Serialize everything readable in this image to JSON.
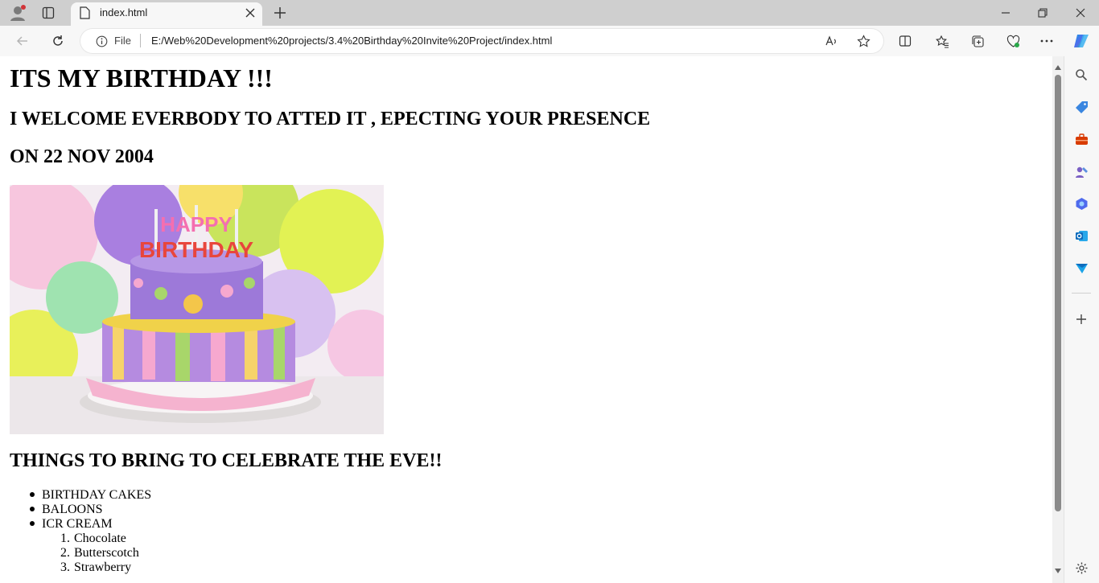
{
  "browser": {
    "tab_title": "index.html",
    "address_prefix": "File",
    "url": "E:/Web%20Development%20projects/3.4%20Birthday%20Invite%20Project/index.html"
  },
  "page": {
    "heading": "ITS MY BIRTHDAY !!!",
    "welcome": "I WELCOME EVERBODY TO ATTED IT , EPECTING YOUR PRESENCE",
    "date_line": "ON 22 NOV 2004",
    "image_text": "HAPPY BIRTHDAY",
    "things_heading": "THINGS TO BRING TO CELEBRATE THE EVE!!",
    "items": [
      "BIRTHDAY CAKES",
      "BALOONS",
      "ICR CREAM"
    ],
    "ice_cream_flavors": [
      "Chocolate",
      "Butterscotch",
      "Strawberry"
    ],
    "flavor_numbers": [
      "1.",
      "2.",
      "3."
    ]
  },
  "colors": {
    "sidebar_blue": "#0f6cbd",
    "sidebar_red": "#d83b01",
    "scroll_thumb": "#8a8a8a"
  }
}
